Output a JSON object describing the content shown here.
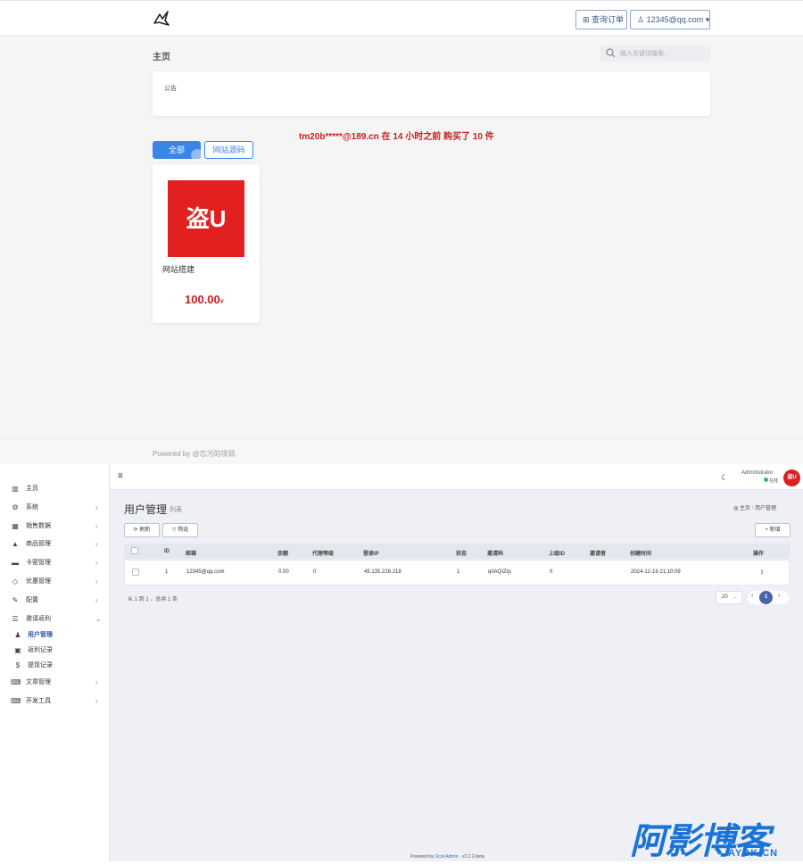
{
  "shop": {
    "header": {
      "order_query_label": "查询订单",
      "user_label": "12345@qq.com"
    },
    "page_title": "主页",
    "search": {
      "placeholder": "输入关键词搜索..."
    },
    "notice_label": "公告",
    "purchase_ticker": "tm20b*****@189.cn 在 14 小时之前 购买了 10 件",
    "categories": [
      {
        "label": "全部",
        "active": true
      },
      {
        "label": "网站源码",
        "active": false
      }
    ],
    "products": [
      {
        "image_text": "盗U",
        "name": "网站搭建",
        "price": "100.00",
        "currency": "¥"
      }
    ],
    "footer": "Powered by @忘污的项目."
  },
  "admin": {
    "sidebar": {
      "items": [
        {
          "icon": "bar-chart-icon",
          "label": "主页",
          "has_arrow": false
        },
        {
          "icon": "gear-icon",
          "label": "系统",
          "has_arrow": true
        },
        {
          "icon": "table-icon",
          "label": "销售数据",
          "has_arrow": true
        },
        {
          "icon": "shopping-bag-icon",
          "label": "商品管理",
          "has_arrow": true
        },
        {
          "icon": "credit-card-icon",
          "label": "卡密管理",
          "has_arrow": true
        },
        {
          "icon": "diamond-icon",
          "label": "优惠管理",
          "has_arrow": true
        },
        {
          "icon": "wrench-icon",
          "label": "配置",
          "has_arrow": true
        },
        {
          "icon": "list-icon",
          "label": "邀请返利",
          "has_arrow": true,
          "expanded": true
        },
        {
          "icon": "users-icon",
          "label": "用户管理",
          "sub": true,
          "active": true
        },
        {
          "icon": "calendar-icon",
          "label": "返利记录",
          "sub": true
        },
        {
          "icon": "dollar-icon",
          "label": "提现记录",
          "sub": true
        },
        {
          "icon": "keyboard-icon",
          "label": "文章管理",
          "has_arrow": true
        },
        {
          "icon": "keyboard-icon",
          "label": "开发工具",
          "has_arrow": true
        }
      ]
    },
    "header": {
      "admin_name": "Administrator",
      "status": "在线",
      "avatar_text": "盗U"
    },
    "main": {
      "title": "用户管理",
      "subtitle": "列表",
      "breadcrumb_home": "主页",
      "breadcrumb_current": "用户管理",
      "refresh_label": "刷新",
      "filter_label": "筛选",
      "add_label": "新增"
    },
    "table": {
      "headers": [
        "ID",
        "邮箱",
        "余额",
        "代理等级",
        "登录IP",
        "状态",
        "邀请码",
        "上级ID",
        "邀请者",
        "创建时间",
        "操作"
      ],
      "rows": [
        {
          "id": "1",
          "email": "12345@qq.com",
          "balance": "0.00",
          "level": "0",
          "ip": "45.135.228.218",
          "status": "1",
          "invite_code": "q0AQIZIp",
          "parent_id": "0",
          "inviter": "",
          "created": "2024-12-19 21:10:09",
          "action": "⋮"
        }
      ]
    },
    "pagination": {
      "info": "从 1 到 1 ，总共 1 条",
      "page_size": "20",
      "current_page": "1"
    },
    "footer": {
      "prefix": "Powered by",
      "link": "Dcat Admin",
      "version": "· v2.2.2-beta"
    }
  },
  "watermark": {
    "main": "阿影博客",
    "sub": "AYBK.CN"
  }
}
